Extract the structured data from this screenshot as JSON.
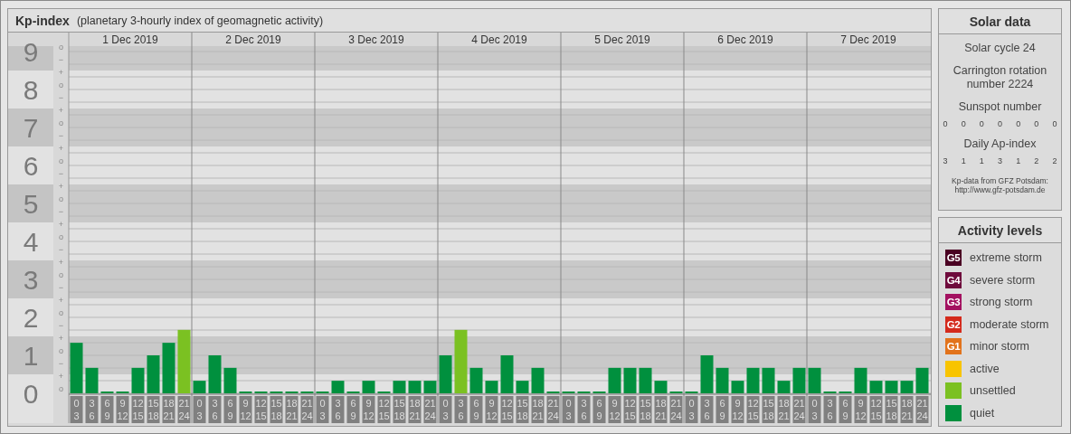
{
  "kp_panel": {
    "title": "Kp-index",
    "subtitle": "(planetary 3-hourly index of geomagnetic activity)",
    "subtick_labels": [
      "o",
      "−",
      "+",
      "o",
      "−",
      "+",
      "o",
      "−",
      "+",
      "o",
      "−",
      "+",
      "o",
      "−",
      "+",
      "o",
      "−",
      "+",
      "o",
      "−",
      "+",
      "o",
      "−",
      "+",
      "o",
      "−",
      "+",
      "o"
    ],
    "days": [
      {
        "date": "1 Dec 2019",
        "slots": [
          {
            "start": "0",
            "end": "3"
          },
          {
            "start": "3",
            "end": "6"
          },
          {
            "start": "6",
            "end": "9"
          },
          {
            "start": "9",
            "end": "12"
          },
          {
            "start": "12",
            "end": "15"
          },
          {
            "start": "15",
            "end": "18"
          },
          {
            "start": "18",
            "end": "21"
          },
          {
            "start": "21",
            "end": "24"
          }
        ]
      },
      {
        "date": "2 Dec 2019",
        "slots": [
          {
            "start": "0",
            "end": "3"
          },
          {
            "start": "3",
            "end": "6"
          },
          {
            "start": "6",
            "end": "9"
          },
          {
            "start": "9",
            "end": "12"
          },
          {
            "start": "12",
            "end": "15"
          },
          {
            "start": "15",
            "end": "18"
          },
          {
            "start": "18",
            "end": "21"
          },
          {
            "start": "21",
            "end": "24"
          }
        ]
      },
      {
        "date": "3 Dec 2019",
        "slots": [
          {
            "start": "0",
            "end": "3"
          },
          {
            "start": "3",
            "end": "6"
          },
          {
            "start": "6",
            "end": "9"
          },
          {
            "start": "9",
            "end": "12"
          },
          {
            "start": "12",
            "end": "15"
          },
          {
            "start": "15",
            "end": "18"
          },
          {
            "start": "18",
            "end": "21"
          },
          {
            "start": "21",
            "end": "24"
          }
        ]
      },
      {
        "date": "4 Dec 2019",
        "slots": [
          {
            "start": "0",
            "end": "3"
          },
          {
            "start": "3",
            "end": "6"
          },
          {
            "start": "6",
            "end": "9"
          },
          {
            "start": "9",
            "end": "12"
          },
          {
            "start": "12",
            "end": "15"
          },
          {
            "start": "15",
            "end": "18"
          },
          {
            "start": "18",
            "end": "21"
          },
          {
            "start": "21",
            "end": "24"
          }
        ]
      },
      {
        "date": "5 Dec 2019",
        "slots": [
          {
            "start": "0",
            "end": "3"
          },
          {
            "start": "3",
            "end": "6"
          },
          {
            "start": "6",
            "end": "9"
          },
          {
            "start": "9",
            "end": "12"
          },
          {
            "start": "12",
            "end": "15"
          },
          {
            "start": "15",
            "end": "18"
          },
          {
            "start": "18",
            "end": "21"
          },
          {
            "start": "21",
            "end": "24"
          }
        ]
      },
      {
        "date": "6 Dec 2019",
        "slots": [
          {
            "start": "0",
            "end": "3"
          },
          {
            "start": "3",
            "end": "6"
          },
          {
            "start": "6",
            "end": "9"
          },
          {
            "start": "9",
            "end": "12"
          },
          {
            "start": "12",
            "end": "15"
          },
          {
            "start": "15",
            "end": "18"
          },
          {
            "start": "18",
            "end": "21"
          },
          {
            "start": "21",
            "end": "24"
          }
        ]
      },
      {
        "date": "7 Dec 2019",
        "slots": [
          {
            "start": "0",
            "end": "3"
          },
          {
            "start": "3",
            "end": "6"
          },
          {
            "start": "6",
            "end": "9"
          },
          {
            "start": "9",
            "end": "12"
          },
          {
            "start": "12",
            "end": "15"
          },
          {
            "start": "15",
            "end": "18"
          },
          {
            "start": "18",
            "end": "21"
          },
          {
            "start": "21",
            "end": "24"
          }
        ]
      }
    ],
    "chart_data": {
      "type": "bar",
      "ylim": [
        0,
        9
      ],
      "grid": true,
      "bands": [
        {
          "axis": "y",
          "from": 0.5,
          "to": 1.5
        },
        {
          "axis": "y",
          "from": 2.5,
          "to": 3.5
        },
        {
          "axis": "y",
          "from": 4.5,
          "to": 5.5
        },
        {
          "axis": "y",
          "from": 6.5,
          "to": 7.5
        },
        {
          "axis": "y",
          "from": 8.5,
          "to": 9.14
        }
      ],
      "yticks": [
        {
          "value": 0,
          "label": "0"
        },
        {
          "value": 1,
          "label": "1"
        },
        {
          "value": 2,
          "label": "2"
        },
        {
          "value": 3,
          "label": "3"
        },
        {
          "value": 4,
          "label": "4"
        },
        {
          "value": 5,
          "label": "5"
        },
        {
          "value": 6,
          "label": "6"
        },
        {
          "value": 7,
          "label": "7"
        },
        {
          "value": 8,
          "label": "8"
        },
        {
          "value": 9,
          "label": "9"
        }
      ],
      "series": [
        {
          "values": [
            1.33,
            0.67,
            0,
            0,
            0.67,
            1,
            1.33,
            1.67,
            0.33,
            1,
            0.67,
            0,
            0,
            0,
            0,
            0,
            0,
            0.33,
            0,
            0.33,
            0,
            0.33,
            0.33,
            0.33,
            1,
            1.67,
            0.67,
            0.33,
            1,
            0.33,
            0.67,
            0,
            0,
            0,
            0,
            0.67,
            0.67,
            0.67,
            0.33,
            0,
            0,
            1,
            0.67,
            0.33,
            0.67,
            0.67,
            0.33,
            0.67,
            0.67,
            0,
            0,
            0.67,
            0.33,
            0.33,
            0.33,
            0.67
          ]
        }
      ]
    }
  },
  "solar_data": {
    "title": "Solar data",
    "solar_cycle": "Solar cycle 24",
    "carrington": "Carrington rotation number 2224",
    "sunspot_title": "Sunspot number",
    "sunspot_values": [
      "0",
      "0",
      "0",
      "0",
      "0",
      "0",
      "0"
    ],
    "ap_title": "Daily Ap-index",
    "ap_values": [
      "3",
      "1",
      "1",
      "3",
      "1",
      "2",
      "2"
    ],
    "credit_lines": [
      "Kp-data from GFZ Potsdam:",
      "http://www.gfz-potsdam.de"
    ]
  },
  "activity_levels": {
    "title": "Activity levels",
    "items": [
      {
        "badge": "G5",
        "label": "extreme storm",
        "color": "#4a0022"
      },
      {
        "badge": "G4",
        "label": "severe storm",
        "color": "#6e0a3c"
      },
      {
        "badge": "G3",
        "label": "strong storm",
        "color": "#a31160"
      },
      {
        "badge": "G2",
        "label": "moderate storm",
        "color": "#d42a1c"
      },
      {
        "badge": "G1",
        "label": "minor storm",
        "color": "#e2731c"
      },
      {
        "label": "active",
        "color": "#f8c400"
      },
      {
        "label": "unsettled",
        "color": "#7bc122"
      },
      {
        "label": "quiet",
        "color": "#00903e"
      }
    ]
  }
}
